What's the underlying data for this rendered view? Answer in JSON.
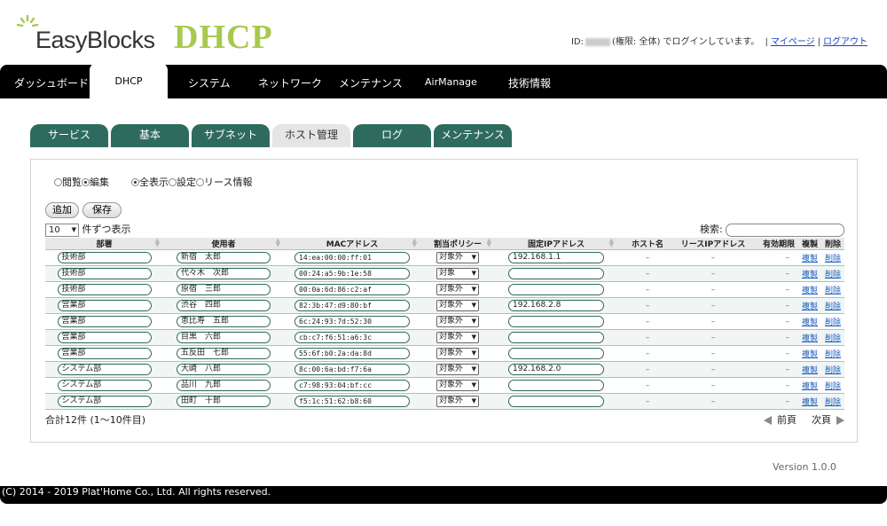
{
  "header": {
    "logo_text": "EasyBlocks",
    "app_title": "DHCP",
    "user_prefix": "ID:",
    "user_suffix": "(権限: 全体) でログインしています。",
    "sep": "|",
    "mypage_link": "マイページ",
    "logout_link": "ログアウト",
    "accent_color": "#a8c94e"
  },
  "mainnav": {
    "items": [
      "ダッシュボード",
      "DHCP",
      "システム",
      "ネットワーク",
      "メンテナンス",
      "AirManage",
      "技術情報"
    ],
    "active": "DHCP"
  },
  "subtabs": {
    "items": [
      "サービス",
      "基本",
      "サブネット",
      "ホスト管理",
      "ログ",
      "メンテナンス"
    ],
    "active": "ホスト管理",
    "color": "#2e6b5e"
  },
  "radios": {
    "mode": [
      "閲覧",
      "編集"
    ],
    "mode_selected": "編集",
    "view": [
      "全表示",
      "設定",
      "リース情報"
    ],
    "view_selected": "全表示"
  },
  "buttons": {
    "add": "追加",
    "save": "保存"
  },
  "pagesize": {
    "value": "10",
    "suffix": "件ずつ表示"
  },
  "search": {
    "label": "検索:",
    "value": ""
  },
  "table": {
    "headers": [
      "部署",
      "使用者",
      "MACアドレス",
      "割当ポリシー",
      "固定IPアドレス",
      "ホスト名",
      "リースIPアドレス",
      "有効期限",
      "複製",
      "削除"
    ],
    "rows": [
      {
        "dept": "技術部",
        "user": "新宿　太郎",
        "mac": "14:ea:00:00:ff:01",
        "policy": "対象外",
        "ip": "192.168.1.1",
        "host": "–",
        "lease": "–",
        "exp": "–",
        "copy": "複製",
        "del": "削除"
      },
      {
        "dept": "技術部",
        "user": "代々木　次郎",
        "mac": "00:24:a5:9b:1e:58",
        "policy": "対象",
        "ip": "",
        "host": "–",
        "lease": "–",
        "exp": "–",
        "copy": "複製",
        "del": "削除"
      },
      {
        "dept": "技術部",
        "user": "原宿　三郎",
        "mac": "00:0a:6d:86:c2:af",
        "policy": "対象外",
        "ip": "",
        "host": "–",
        "lease": "–",
        "exp": "–",
        "copy": "複製",
        "del": "削除"
      },
      {
        "dept": "営業部",
        "user": "渋谷　四郎",
        "mac": "82:3b:47:d9:80:bf",
        "policy": "対象外",
        "ip": "192.168.2.8",
        "host": "–",
        "lease": "–",
        "exp": "–",
        "copy": "複製",
        "del": "削除"
      },
      {
        "dept": "営業部",
        "user": "恵比寿　五郎",
        "mac": "6c:24:93:7d:52:30",
        "policy": "対象外",
        "ip": "",
        "host": "–",
        "lease": "–",
        "exp": "–",
        "copy": "複製",
        "del": "削除"
      },
      {
        "dept": "営業部",
        "user": "目黒　六郎",
        "mac": "cb:c7:f6:51:a6:3c",
        "policy": "対象外",
        "ip": "",
        "host": "–",
        "lease": "–",
        "exp": "–",
        "copy": "複製",
        "del": "削除"
      },
      {
        "dept": "営業部",
        "user": "五反田　七郎",
        "mac": "55:6f:b0:2a:da:8d",
        "policy": "対象外",
        "ip": "",
        "host": "–",
        "lease": "–",
        "exp": "–",
        "copy": "複製",
        "del": "削除"
      },
      {
        "dept": "システム部",
        "user": "大崎　八郎",
        "mac": "8c:00:6a:bd:f7:6a",
        "policy": "対象外",
        "ip": "192.168.2.0",
        "host": "–",
        "lease": "–",
        "exp": "–",
        "copy": "複製",
        "del": "削除"
      },
      {
        "dept": "システム部",
        "user": "品川　九郎",
        "mac": "c7:98:93:04:bf:cc",
        "policy": "対象外",
        "ip": "",
        "host": "–",
        "lease": "–",
        "exp": "–",
        "copy": "複製",
        "del": "削除"
      },
      {
        "dept": "システム部",
        "user": "田町　十郎",
        "mac": "f5:1c:51:62:b8:60",
        "policy": "対象外",
        "ip": "",
        "host": "–",
        "lease": "–",
        "exp": "–",
        "copy": "複製",
        "del": "削除"
      }
    ]
  },
  "footer_count": "合計12件 (1〜10件目)",
  "pager": {
    "prev": "前頁",
    "next": "次頁"
  },
  "version": "Version 1.0.0",
  "copyright": "(C) 2014 - 2019 Plat'Home Co., Ltd. All rights reserved."
}
